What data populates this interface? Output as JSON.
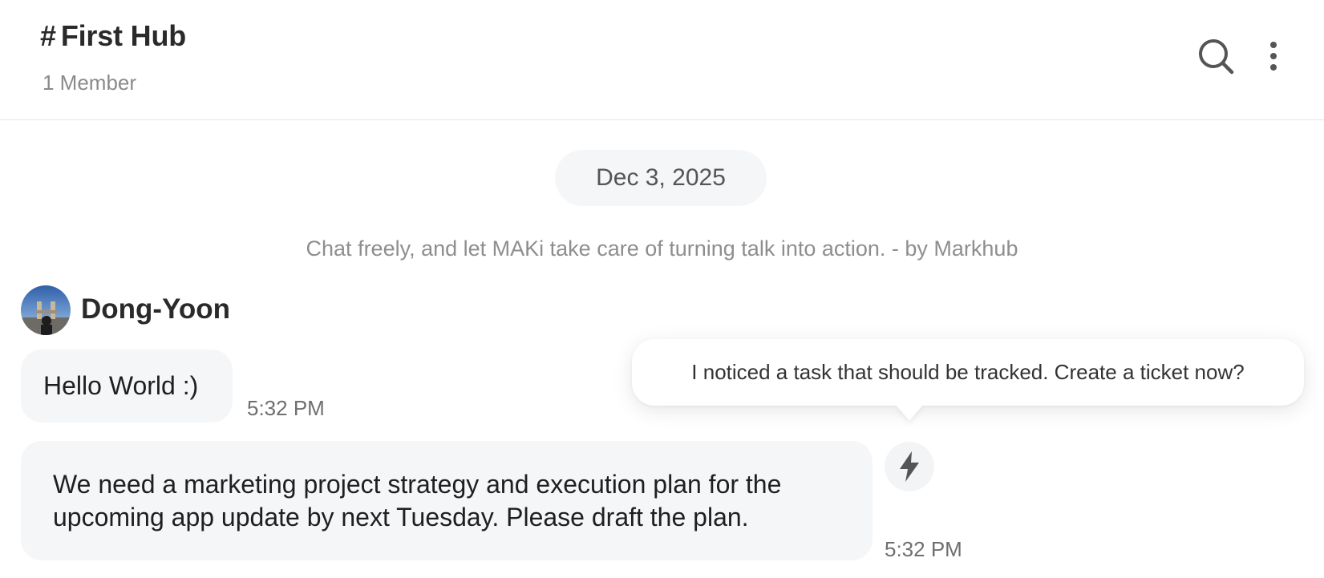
{
  "header": {
    "hash": "#",
    "title": "First Hub",
    "member_count": "1 Member",
    "icons": [
      "search-icon",
      "more-vertical-icon"
    ]
  },
  "date_divider": "Dec 3, 2025",
  "tagline": "Chat freely, and let MAKi take care of turning talk into action. - by Markhub",
  "sender": {
    "name": "Dong-Yoon",
    "avatar": "avatar-photo"
  },
  "messages": [
    {
      "text": "Hello World :)",
      "time": "5:32 PM"
    },
    {
      "text": "We need a marketing project strategy and execution plan for the upcoming app update by next Tuesday. Please draft the plan.",
      "time": "5:32 PM"
    }
  ],
  "maki": {
    "icon": "lightning-bolt-icon",
    "tooltip": "I noticed a task that should be tracked. Create a ticket now?"
  },
  "colors": {
    "bubble_bg": "#f5f6f8",
    "divider": "#e3e4e8",
    "muted_text": "#8e8e8e"
  }
}
